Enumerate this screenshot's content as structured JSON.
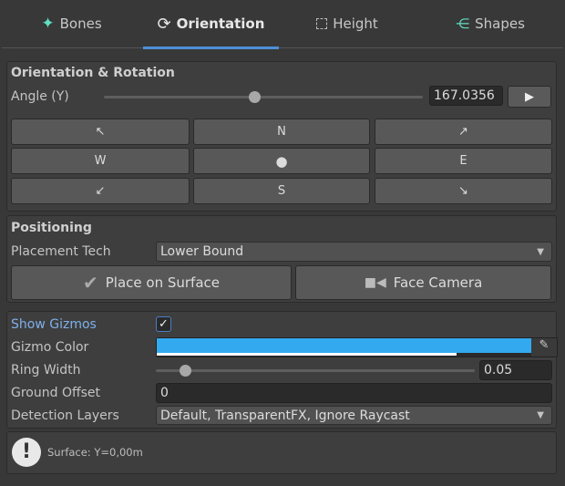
{
  "tabs": [
    {
      "label": "Bones",
      "icon": "humanoid-icon"
    },
    {
      "label": "Orientation",
      "icon": "rotate-icon",
      "active": true
    },
    {
      "label": "Height",
      "icon": "dashed-box-icon"
    },
    {
      "label": "Shapes",
      "icon": "blendshape-icon"
    }
  ],
  "orientation": {
    "title": "Orientation & Rotation",
    "angle_label": "Angle (Y)",
    "angle_value": "167.0356",
    "angle_fraction": 0.47,
    "directions": [
      "↖",
      "N",
      "↗",
      "W",
      "●",
      "E",
      "↙",
      "S",
      "↘"
    ]
  },
  "positioning": {
    "title": "Positioning",
    "placement_label": "Placement Tech",
    "placement_value": "Lower Bound",
    "place_button": "Place on Surface",
    "face_button": "Face Camera"
  },
  "gizmos": {
    "show_label": "Show Gizmos",
    "show_checked": true,
    "color_label": "Gizmo Color",
    "color": "#33aaf0",
    "alpha": 0.8,
    "ring_label": "Ring Width",
    "ring_value": "0.05",
    "ring_fraction": 0.09,
    "offset_label": "Ground Offset",
    "offset_value": "0",
    "layers_label": "Detection Layers",
    "layers_value": "Default, TransparentFX, Ignore Raycast"
  },
  "info": {
    "text": "Surface: Y=0,00m"
  }
}
